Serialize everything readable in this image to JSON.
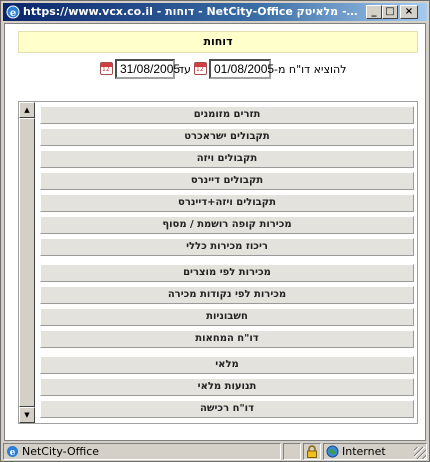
{
  "window": {
    "title": "https://www.vcx.co.il - דוחות - NetCity-Office מלאיטק - Microsoft Internet Explorer",
    "min_glyph": "_",
    "max_glyph": "□",
    "close_glyph": "×"
  },
  "page": {
    "heading": "דוחות",
    "date_filter": {
      "from_label": "להוציא דו\"ח מ-",
      "from_value": "01/08/2005",
      "to_label": "עד",
      "to_value": "31/08/2005",
      "calendar_glyph": "12"
    },
    "reports": [
      "תזרים מזומנים",
      "תקבולים ישראכרט",
      "תקבולים ויזה",
      "תקבולים דיינרס",
      "תקבולים ויזה+דיינרס",
      "מכירות קופה רושמת / מסוף",
      "ריכוז מכירות כללי",
      "מכירות לפי מוצרים",
      "מכירות לפי נקודות מכירה",
      "חשבוניות",
      "דו\"ח המחאות",
      "מלאי",
      "תנועות מלאי",
      "דו\"ח רכישה"
    ]
  },
  "statusbar": {
    "app_label": "NetCity-Office",
    "zone_label": "Internet"
  },
  "colors": {
    "titlebar_start": "#0a246a",
    "titlebar_end": "#a6caf0",
    "heading_bg": "#ffffcc"
  }
}
